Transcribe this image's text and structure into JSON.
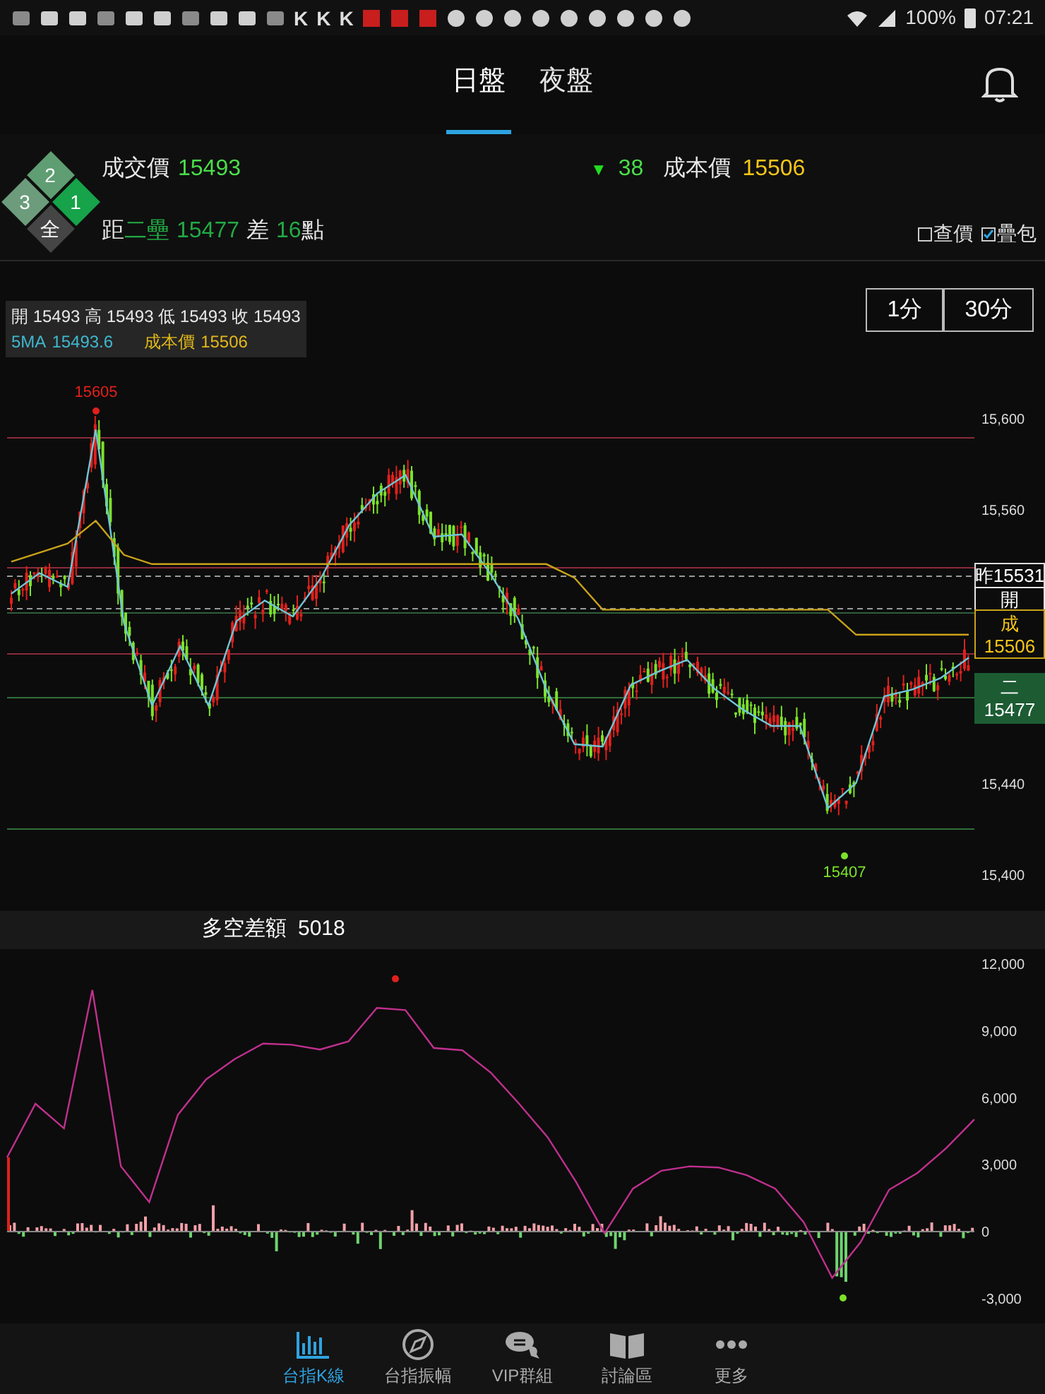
{
  "status_bar": {
    "letter_icons": [
      "K",
      "K",
      "K"
    ],
    "battery": "100%",
    "time": "07:21"
  },
  "tabs": [
    {
      "label": "日盤",
      "selected": true
    },
    {
      "label": "夜盤",
      "selected": false
    }
  ],
  "bases": [
    {
      "label": "2",
      "color": "#5f9e72"
    },
    {
      "label": "3",
      "color": "#6c9c7c"
    },
    {
      "label": "1",
      "color": "#16a34a"
    },
    {
      "label": "全",
      "color": "#454545"
    }
  ],
  "quote": {
    "price_label": "成交價",
    "price": "15493",
    "change_arrow": "▼",
    "change": "38",
    "cost_label": "成本價",
    "cost": "15506"
  },
  "distance": {
    "prefix": "距",
    "base": "二壘",
    "value": "15477",
    "diff_label": "差",
    "diff": "16",
    "unit": "點"
  },
  "options": [
    {
      "label": "查價",
      "checked": false
    },
    {
      "label": "疊包",
      "checked": true
    }
  ],
  "ohlc": {
    "line1": "開 15493 高 15493 低 15493 收 15493",
    "ma_value": "15493.6",
    "cost_value": "15506"
  },
  "intervals": [
    {
      "label": "1分"
    },
    {
      "label": "30分"
    }
  ],
  "price_chart": {
    "chart_data": {
      "type": "line",
      "ylim": [
        15400,
        15600
      ],
      "yticks": [
        {
          "value": 15600,
          "label": "15,600"
        },
        {
          "value": 15560,
          "label": "15,560"
        },
        {
          "value": 15440,
          "label": "15,440"
        },
        {
          "value": 15400,
          "label": "15,400"
        }
      ],
      "series": [
        {
          "name": "5MA",
          "color": "#6fc6d8",
          "values": [
            15523,
            15532,
            15526,
            15595,
            15510,
            15474,
            15500,
            15474,
            15511,
            15520,
            15513,
            15530,
            15553,
            15567,
            15575,
            15548,
            15549,
            15532,
            15512,
            15481,
            15457,
            15456,
            15483,
            15489,
            15494,
            15481,
            15472,
            15465,
            15465,
            15429,
            15440,
            15478,
            15481,
            15486,
            15495
          ]
        },
        {
          "name": "成本價",
          "color": "#c9a21a",
          "values": [
            15537,
            15541,
            15545,
            15555,
            15540,
            15536,
            15536,
            15536,
            15536,
            15536,
            15536,
            15536,
            15536,
            15536,
            15536,
            15536,
            15536,
            15536,
            15536,
            15536,
            15530,
            15516,
            15516,
            15516,
            15516,
            15516,
            15516,
            15516,
            15516,
            15516,
            15505,
            15505,
            15505,
            15505,
            15505
          ]
        }
      ]
    }
  },
  "price_tags": [
    {
      "kind": "prev",
      "label": "昨15531"
    },
    {
      "kind": "open",
      "label": "開"
    },
    {
      "kind": "cost",
      "label": "成",
      "value": "15506"
    },
    {
      "kind": "base",
      "label": "二",
      "value": "15477"
    }
  ],
  "high_label": "15605",
  "low_label": "15407",
  "sub_header": {
    "value": "5018"
  },
  "diff_chart": {
    "chart_data": {
      "type": "line",
      "ylim": [
        -3000,
        12000
      ],
      "yticks": [
        {
          "value": 12000,
          "label": "12,000"
        },
        {
          "value": 9000,
          "label": "9,000"
        },
        {
          "value": 6000,
          "label": "6,000"
        },
        {
          "value": 3000,
          "label": "3,000"
        },
        {
          "value": 0,
          "label": "0"
        },
        {
          "value": -3000,
          "label": "-3,000"
        }
      ],
      "series": [
        {
          "name": "多空差額",
          "color": "#c0308e",
          "values": [
            3300,
            5700,
            4600,
            10800,
            2900,
            1300,
            5200,
            6800,
            7700,
            8400,
            8350,
            8130,
            8500,
            10000,
            9900,
            8200,
            8100,
            7100,
            5700,
            4200,
            2200,
            -100,
            1900,
            2700,
            2900,
            2850,
            2500,
            1900,
            400,
            -2100,
            -500,
            1850,
            2600,
            3700,
            5000
          ]
        }
      ]
    }
  },
  "nav": [
    {
      "label": "台指K線",
      "selected": true
    },
    {
      "label": "台指振幅",
      "selected": false
    },
    {
      "label": "VIP群組",
      "selected": false
    },
    {
      "label": "討論區",
      "selected": false
    },
    {
      "label": "更多",
      "selected": false
    }
  ]
}
